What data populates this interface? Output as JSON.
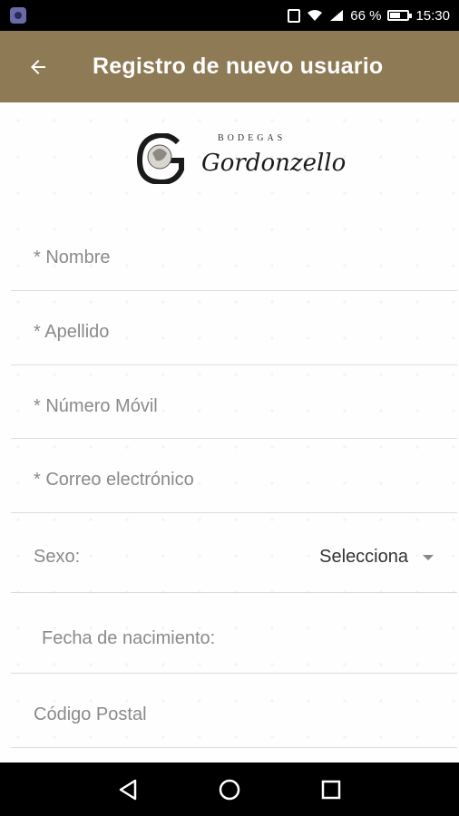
{
  "status_bar": {
    "battery": "66 %",
    "time": "15:30",
    "icons": [
      "app-notification-icon",
      "nfc-icon",
      "wifi-icon",
      "signal-icon",
      "battery-icon"
    ]
  },
  "app_bar": {
    "back_icon": "arrow-left-icon",
    "title": "Registro de nuevo usuario",
    "background": "#8e7a55"
  },
  "logo": {
    "subtitle": "BODEGAS",
    "name": "Gordonzello"
  },
  "form": {
    "nombre": "* Nombre",
    "apellido": "* Apellido",
    "movil": "* Número Móvil",
    "correo": "* Correo electrónico",
    "sexo_label": "Sexo:",
    "sexo_value": "Selecciona",
    "fecha": "Fecha de nacimiento:",
    "codigo_postal": "Código Postal"
  },
  "nav_bar": {
    "icons": [
      "back-triangle-icon",
      "home-circle-icon",
      "recents-square-icon"
    ]
  }
}
